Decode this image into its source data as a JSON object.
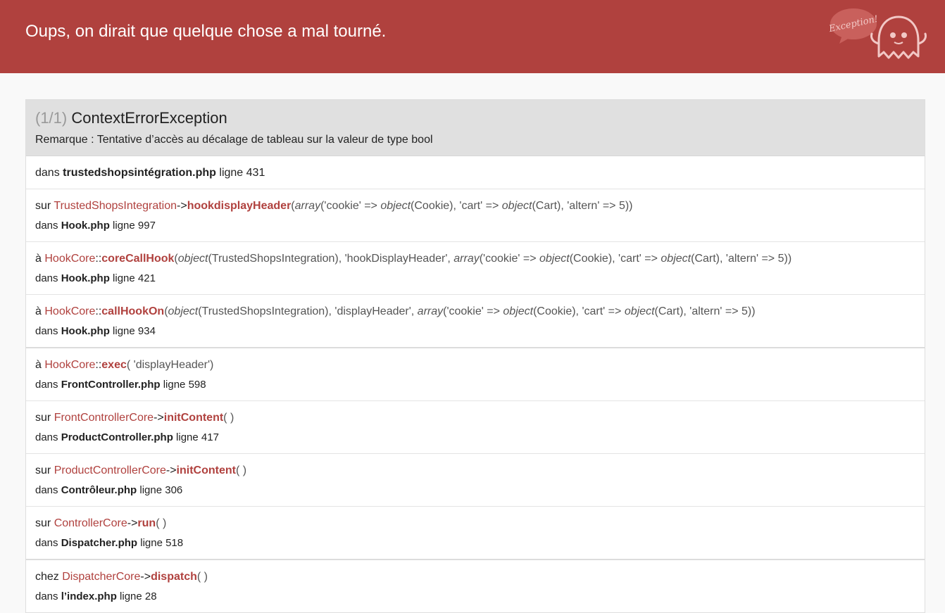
{
  "header": {
    "title": "Oups, on dirait que quelque chose a mal tourné.",
    "logo_text": "Exception!"
  },
  "exception": {
    "count": "(1/1)",
    "class_name": "ContextErrorException",
    "message": "Remarque : Tentative d’accès au décalage de tableau sur la valeur de type bool",
    "first_location": {
      "prefix": "dans",
      "file": "trustedshopsintégration.php",
      "line_label": "ligne 431"
    }
  },
  "trace": [
    {
      "prefix": "sur",
      "cls": "TrustedShopsIntegration",
      "op": "->",
      "fn": "hookdisplayHeader",
      "args_parts": [
        "(",
        "array",
        "('cookie' => ",
        "object",
        "(Cookie), 'cart' => ",
        "object",
        "(Cart), 'altern' => 5))"
      ],
      "loc_prefix": "dans",
      "file": "Hook.php",
      "line_label": "ligne 997"
    },
    {
      "prefix": "à",
      "cls": "HookCore",
      "op": "::",
      "fn": "coreCallHook",
      "args_parts": [
        "(",
        "object",
        "(TrustedShopsIntegration), 'hookDisplayHeader', ",
        "array",
        "('cookie' => ",
        "object",
        "(Cookie), 'cart' => ",
        "object",
        "(Cart), 'altern' => 5))"
      ],
      "loc_prefix": "dans",
      "file": "Hook.php",
      "line_label": "ligne 421"
    },
    {
      "prefix": "à",
      "cls": "HookCore",
      "op": "::",
      "fn": "callHookOn",
      "args_parts": [
        "(",
        "object",
        "(TrustedShopsIntegration), 'displayHeader', ",
        "array",
        "('cookie' => ",
        "object",
        "(Cookie), 'cart' => ",
        "object",
        "(Cart), 'altern' => 5))"
      ],
      "loc_prefix": "dans",
      "file": "Hook.php",
      "line_label": "ligne 934"
    },
    {
      "prefix": "à",
      "cls": "HookCore",
      "op": "::",
      "fn": "exec",
      "args_parts": [
        "( 'displayHeader')"
      ],
      "loc_prefix": "dans",
      "file": "FrontController.php",
      "line_label": "ligne 598",
      "group_start": true
    },
    {
      "prefix": "sur",
      "cls": "FrontControllerCore",
      "op": "->",
      "fn": "initContent",
      "args_parts": [
        "( )"
      ],
      "loc_prefix": "dans",
      "file": "ProductController.php",
      "line_label": "ligne 417"
    },
    {
      "prefix": "sur",
      "cls": "ProductControllerCore",
      "op": "->",
      "fn": "initContent",
      "args_parts": [
        "( )"
      ],
      "loc_prefix": "dans",
      "file": "Contrôleur.php",
      "line_label": "ligne 306"
    },
    {
      "prefix": "sur",
      "cls": "ControllerCore",
      "op": "->",
      "fn": "run",
      "args_parts": [
        "( )"
      ],
      "loc_prefix": "dans",
      "file": "Dispatcher.php",
      "line_label": "ligne 518"
    },
    {
      "prefix": "chez",
      "cls": "DispatcherCore",
      "op": "->",
      "fn": "dispatch",
      "args_parts": [
        "( )"
      ],
      "loc_prefix": "dans",
      "file": "l’index.php",
      "line_label": "ligne 28",
      "group_start": true
    }
  ]
}
